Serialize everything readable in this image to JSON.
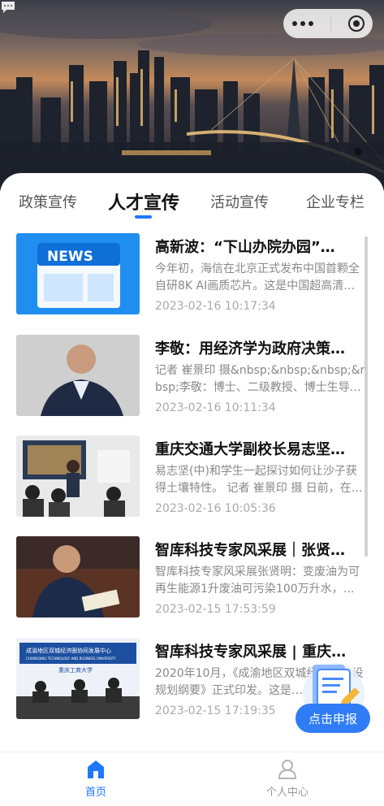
{
  "top_bar": {
    "chat_icon": "chat-bubble-icon",
    "capsule_more_icon": "more-dots-icon",
    "capsule_close_icon": "target-circle-icon"
  },
  "tabs": [
    {
      "label": "政策宣传",
      "active": false
    },
    {
      "label": "人才宣传",
      "active": true
    },
    {
      "label": "活动宣传",
      "active": false
    },
    {
      "label": "企业专栏",
      "active": false
    }
  ],
  "articles": [
    {
      "title": "高新波：“下山办院办园”…",
      "summary": "今年初，海信在北京正式发布中国首颗全自研8K AI画质芯片。这是中国超高清…",
      "date": "2023-02-16 10:17:34",
      "thumb_text": "NEWS"
    },
    {
      "title": "李敬：用经济学为政府决策…",
      "summary": "记者 崔景印 摄&nbsp;&nbsp;&nbsp;&nbsp;李敬：博士、二级教授、博士生导…",
      "date": "2023-02-16 10:11:34"
    },
    {
      "title": "重庆交通大学副校长易志坚…",
      "summary": "易志坚(中)和学生一起探讨如何让沙子获得土壤特性。 记者 崔景印 摄 日前，在…",
      "date": "2023-02-16 10:05:36"
    },
    {
      "title": "智库科技专家风采展｜张贤…",
      "summary": "智库科技专家风采展张贤明：变废油为可再生能源1升废油可污染100万升水，…",
      "date": "2023-02-15 17:53:59"
    },
    {
      "title": "智库科技专家风采展 | 重庆…",
      "summary": "2020年10月，《成渝地区双城经济圈建设规划纲要》正式印发。这是…",
      "date": "2023-02-15 17:19:35",
      "thumb_banner": "成渝地区双城经济圈协同发展中心",
      "thumb_banner_en": "CHONGQING TECHNOLOGY AND BUSINESS UNIVERSITY",
      "thumb_sub": "重庆工商大学"
    }
  ],
  "fab": {
    "label": "点击申报"
  },
  "bottom_nav": [
    {
      "label": "首页",
      "icon": "home-icon",
      "active": true
    },
    {
      "label": "个人中心",
      "icon": "person-icon",
      "active": false
    }
  ],
  "colors": {
    "accent": "#1e78ff",
    "inactive": "#999999"
  }
}
